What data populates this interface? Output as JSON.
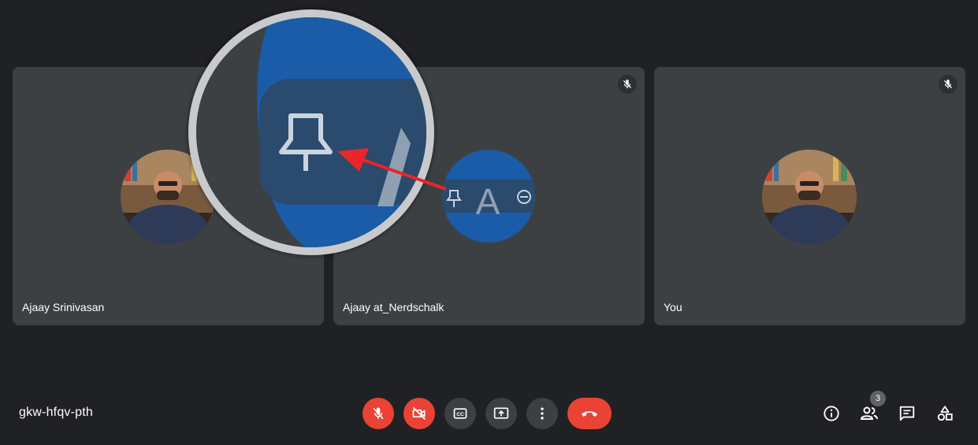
{
  "participants": [
    {
      "name": "Ajaay Srinivasan"
    },
    {
      "name": "Ajaay at_Nerdschalk"
    },
    {
      "name": "You"
    }
  ],
  "meeting": {
    "code": "gkw-hfqv-pth"
  },
  "people": {
    "count": "3"
  },
  "callout": {
    "glyph": "A"
  },
  "colors": {
    "background": "#202124",
    "tile": "#3c4043",
    "danger": "#ea4335",
    "highlight": "#1a5ca8",
    "arrow": "#e8262b"
  },
  "icons": {
    "controls": [
      "mic-off-icon",
      "camera-off-icon",
      "captions-icon",
      "present-icon",
      "more-options-icon",
      "hang-up-icon"
    ],
    "right": [
      "info-icon",
      "people-icon",
      "chat-icon",
      "activities-icon"
    ],
    "tile_overlay": [
      "pin-icon",
      "remove-icon"
    ]
  }
}
